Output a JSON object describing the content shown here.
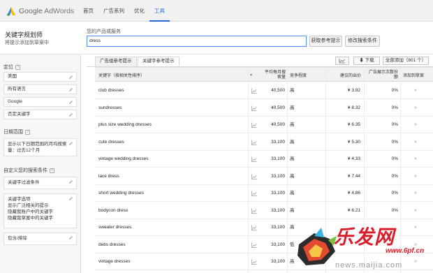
{
  "brand": {
    "google": "Google",
    "adwords": "AdWords"
  },
  "nav": [
    "首页",
    "广告系列",
    "优化",
    "工具"
  ],
  "tool": {
    "title": "关键字规划师",
    "subtitle": "将提示添加到草案中"
  },
  "product": {
    "label": "您的产品或服务",
    "value": "dress",
    "get_button": "获取参考提示",
    "modify_button": "修改搜索条件"
  },
  "sidebar": {
    "targeting_title": "定位",
    "targeting_items": [
      "美国",
      "所有语言",
      "Google",
      "否定关键字"
    ],
    "date_title": "日期范围",
    "date_line1": "显示以下日期范围的月均搜索",
    "date_line2": "量：过去12个月",
    "custom_title": "自定义您的搜索条件",
    "kw_filter": "关键字过滤条件",
    "kw_options_title": "关键字选项",
    "kw_options": [
      "显示广泛相关的提示",
      "隐藏我账户中的关键字",
      "隐藏我草案中的关键字"
    ],
    "include_exclude": "包含/排除"
  },
  "tabs": [
    "广告组参考提示",
    "关键字参考提示"
  ],
  "toolbar": {
    "download": "下载",
    "add_all": "全部添加（801 个）"
  },
  "table": {
    "headers": {
      "keyword": "关键字（按相关性排序）",
      "volume_line1": "平均每月搜",
      "volume_line2": "索量",
      "competition": "竞争程度",
      "bid": "建议的出价",
      "share_line1": "广告展示次数份",
      "share_line2": "额",
      "add": "添加到草案"
    },
    "rows": [
      {
        "keyword": "club dresses",
        "volume": "40,500",
        "competition": "高",
        "bid": "¥ 3.92",
        "share": "0%"
      },
      {
        "keyword": "sundresses",
        "volume": "40,500",
        "competition": "高",
        "bid": "¥ 8.32",
        "share": "0%"
      },
      {
        "keyword": "plus size wedding dresses",
        "volume": "40,500",
        "competition": "高",
        "bid": "¥ 6.35",
        "share": "0%"
      },
      {
        "keyword": "cute dresses",
        "volume": "33,100",
        "competition": "高",
        "bid": "¥ 5.30",
        "share": "0%"
      },
      {
        "keyword": "vintage wedding dresses",
        "volume": "33,100",
        "competition": "高",
        "bid": "¥ 4.33",
        "share": "0%"
      },
      {
        "keyword": "lace dress",
        "volume": "33,100",
        "competition": "高",
        "bid": "¥ 7.44",
        "share": "0%"
      },
      {
        "keyword": "short wedding dresses",
        "volume": "33,100",
        "competition": "高",
        "bid": "¥ 4.86",
        "share": "0%"
      },
      {
        "keyword": "bodycon dress",
        "volume": "33,100",
        "competition": "高",
        "bid": "¥ 6.21",
        "share": "0%"
      },
      {
        "keyword": "sweater dresses",
        "volume": "33,100",
        "competition": "高",
        "bid": "",
        "share": ""
      },
      {
        "keyword": "debs dresses",
        "volume": "33,100",
        "competition": "低",
        "bid": "",
        "share": ""
      },
      {
        "keyword": "vintage dresses",
        "volume": "33,100",
        "competition": "高",
        "bid": "",
        "share": ""
      }
    ]
  },
  "watermark": {
    "brand": "乐发网",
    "url": "news.maijia.com",
    "site": "www.6pf.cn"
  },
  "colors": {
    "accent": "#2a6ad8",
    "border": "#e0e0e0",
    "header_bg": "#f1f1f1",
    "watermark_red": "#d81e2a"
  }
}
